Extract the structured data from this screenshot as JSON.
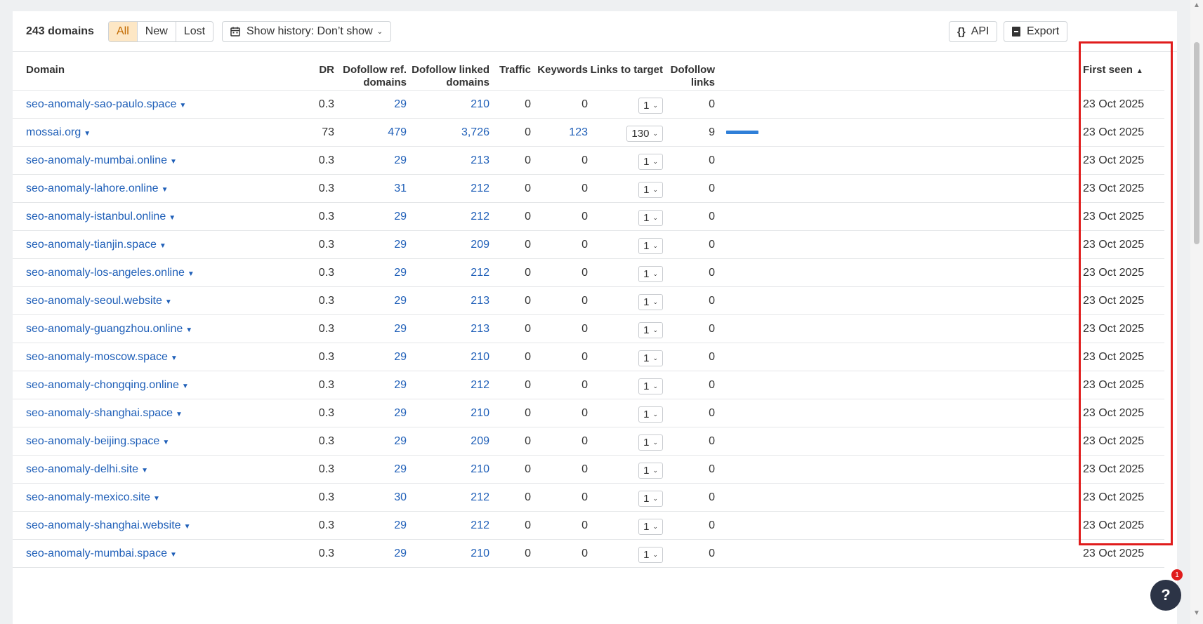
{
  "toolbar": {
    "count": "243 domains",
    "filters": [
      "All",
      "New",
      "Lost"
    ],
    "history_label": "Show history: Don’t show",
    "api_label": "API",
    "export_label": "Export"
  },
  "columns": {
    "domain": "Domain",
    "dr": "DR",
    "dofollow_ref_1": "Dofollow ref.",
    "dofollow_ref_2": "domains",
    "dofollow_linked_1": "Dofollow linked",
    "dofollow_linked_2": "domains",
    "traffic": "Traffic",
    "keywords": "Keywords",
    "links_to_target": "Links to target",
    "dofollow_links_1": "Dofollow",
    "dofollow_links_2": "links",
    "first_seen": "First seen"
  },
  "rows": [
    {
      "domain": "seo-anomaly-sao-paulo.space",
      "dr": "0.3",
      "ref": "29",
      "linked": "210",
      "traffic": "0",
      "keywords": "0",
      "links": "1",
      "dofollow": "0",
      "bar": 0,
      "first_seen": "23 Oct 2025"
    },
    {
      "domain": "mossai.org",
      "dr": "73",
      "ref": "479",
      "linked": "3,726",
      "traffic": "0",
      "keywords": "123",
      "links": "130",
      "dofollow": "9",
      "bar": 9,
      "first_seen": "23 Oct 2025"
    },
    {
      "domain": "seo-anomaly-mumbai.online",
      "dr": "0.3",
      "ref": "29",
      "linked": "213",
      "traffic": "0",
      "keywords": "0",
      "links": "1",
      "dofollow": "0",
      "bar": 0,
      "first_seen": "23 Oct 2025"
    },
    {
      "domain": "seo-anomaly-lahore.online",
      "dr": "0.3",
      "ref": "31",
      "linked": "212",
      "traffic": "0",
      "keywords": "0",
      "links": "1",
      "dofollow": "0",
      "bar": 0,
      "first_seen": "23 Oct 2025"
    },
    {
      "domain": "seo-anomaly-istanbul.online",
      "dr": "0.3",
      "ref": "29",
      "linked": "212",
      "traffic": "0",
      "keywords": "0",
      "links": "1",
      "dofollow": "0",
      "bar": 0,
      "first_seen": "23 Oct 2025"
    },
    {
      "domain": "seo-anomaly-tianjin.space",
      "dr": "0.3",
      "ref": "29",
      "linked": "209",
      "traffic": "0",
      "keywords": "0",
      "links": "1",
      "dofollow": "0",
      "bar": 0,
      "first_seen": "23 Oct 2025"
    },
    {
      "domain": "seo-anomaly-los-angeles.online",
      "dr": "0.3",
      "ref": "29",
      "linked": "212",
      "traffic": "0",
      "keywords": "0",
      "links": "1",
      "dofollow": "0",
      "bar": 0,
      "first_seen": "23 Oct 2025"
    },
    {
      "domain": "seo-anomaly-seoul.website",
      "dr": "0.3",
      "ref": "29",
      "linked": "213",
      "traffic": "0",
      "keywords": "0",
      "links": "1",
      "dofollow": "0",
      "bar": 0,
      "first_seen": "23 Oct 2025"
    },
    {
      "domain": "seo-anomaly-guangzhou.online",
      "dr": "0.3",
      "ref": "29",
      "linked": "213",
      "traffic": "0",
      "keywords": "0",
      "links": "1",
      "dofollow": "0",
      "bar": 0,
      "first_seen": "23 Oct 2025"
    },
    {
      "domain": "seo-anomaly-moscow.space",
      "dr": "0.3",
      "ref": "29",
      "linked": "210",
      "traffic": "0",
      "keywords": "0",
      "links": "1",
      "dofollow": "0",
      "bar": 0,
      "first_seen": "23 Oct 2025"
    },
    {
      "domain": "seo-anomaly-chongqing.online",
      "dr": "0.3",
      "ref": "29",
      "linked": "212",
      "traffic": "0",
      "keywords": "0",
      "links": "1",
      "dofollow": "0",
      "bar": 0,
      "first_seen": "23 Oct 2025"
    },
    {
      "domain": "seo-anomaly-shanghai.space",
      "dr": "0.3",
      "ref": "29",
      "linked": "210",
      "traffic": "0",
      "keywords": "0",
      "links": "1",
      "dofollow": "0",
      "bar": 0,
      "first_seen": "23 Oct 2025"
    },
    {
      "domain": "seo-anomaly-beijing.space",
      "dr": "0.3",
      "ref": "29",
      "linked": "209",
      "traffic": "0",
      "keywords": "0",
      "links": "1",
      "dofollow": "0",
      "bar": 0,
      "first_seen": "23 Oct 2025"
    },
    {
      "domain": "seo-anomaly-delhi.site",
      "dr": "0.3",
      "ref": "29",
      "linked": "210",
      "traffic": "0",
      "keywords": "0",
      "links": "1",
      "dofollow": "0",
      "bar": 0,
      "first_seen": "23 Oct 2025"
    },
    {
      "domain": "seo-anomaly-mexico.site",
      "dr": "0.3",
      "ref": "30",
      "linked": "212",
      "traffic": "0",
      "keywords": "0",
      "links": "1",
      "dofollow": "0",
      "bar": 0,
      "first_seen": "23 Oct 2025"
    },
    {
      "domain": "seo-anomaly-shanghai.website",
      "dr": "0.3",
      "ref": "29",
      "linked": "212",
      "traffic": "0",
      "keywords": "0",
      "links": "1",
      "dofollow": "0",
      "bar": 0,
      "first_seen": "23 Oct 2025"
    },
    {
      "domain": "seo-anomaly-mumbai.space",
      "dr": "0.3",
      "ref": "29",
      "linked": "210",
      "traffic": "0",
      "keywords": "0",
      "links": "1",
      "dofollow": "0",
      "bar": 0,
      "first_seen": "23 Oct 2025"
    }
  ],
  "help": {
    "label": "?",
    "badge": "1"
  },
  "colors": {
    "accent": "#c26a00",
    "link": "#1f5fb8",
    "bar": "#2f7fd8",
    "highlight": "#e01c1c"
  }
}
